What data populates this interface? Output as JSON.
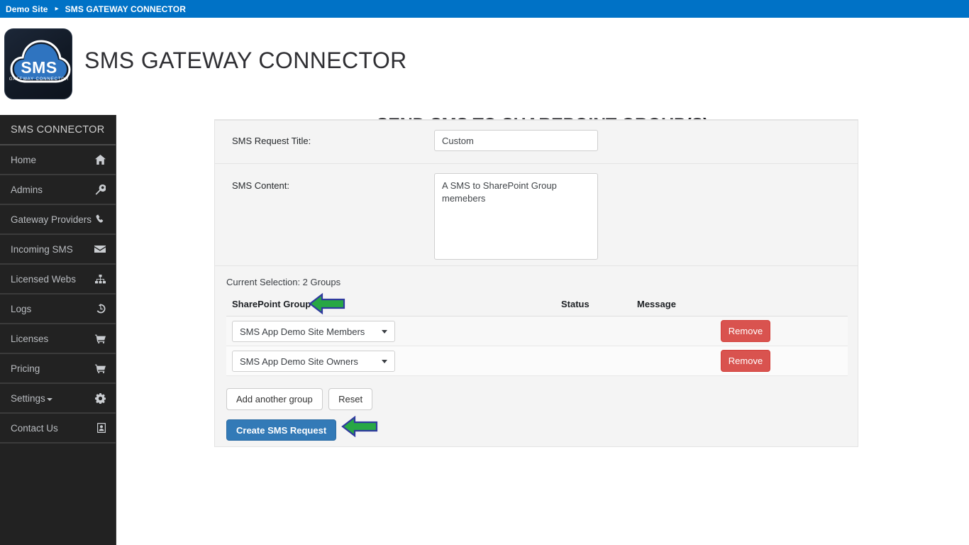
{
  "breadcrumb": {
    "site_label": "Demo Site",
    "separator_icon": "chevron-right-icon",
    "current_label": "SMS GATEWAY CONNECTOR"
  },
  "header": {
    "logo": {
      "icon": "sms-cloud-logo",
      "primary_text": "SMS",
      "secondary_text": "GATEWAY CONNECTOR"
    },
    "title": "SMS GATEWAY CONNECTOR"
  },
  "sidebar": {
    "heading": "SMS CONNECTOR",
    "items": [
      {
        "label": "Home",
        "icon": "home-icon"
      },
      {
        "label": "Admins",
        "icon": "wrench-icon"
      },
      {
        "label": "Gateway Providers",
        "icon": "phone-icon"
      },
      {
        "label": "Incoming SMS",
        "icon": "envelope-icon"
      },
      {
        "label": "Licensed Webs",
        "icon": "sitemap-icon"
      },
      {
        "label": "Logs",
        "icon": "history-icon"
      },
      {
        "label": "Licenses",
        "icon": "cart-icon"
      },
      {
        "label": "Pricing",
        "icon": "cart-icon"
      },
      {
        "label": "Settings",
        "icon": "gear-icon",
        "has_caret": true
      },
      {
        "label": "Contact Us",
        "icon": "address-book-icon"
      }
    ]
  },
  "main": {
    "page_title": "SEND SMS TO SHAREPOINT GROUP(S)",
    "form": {
      "title_label": "SMS Request Title:",
      "title_value": "Custom",
      "content_label": "SMS Content:",
      "content_value": "A SMS to SharePoint Group memebers"
    },
    "selection_note": "Current Selection: 2 Groups",
    "table": {
      "headers": {
        "group": "SharePoint Group",
        "status": "Status",
        "message": "Message"
      },
      "rows": [
        {
          "group": "SMS App Demo Site Members",
          "status": "",
          "message": "",
          "remove_label": "Remove"
        },
        {
          "group": "SMS App Demo Site Owners",
          "status": "",
          "message": "",
          "remove_label": "Remove"
        }
      ]
    },
    "buttons": {
      "add_group": "Add another group",
      "reset": "Reset",
      "create_request": "Create SMS Request"
    }
  },
  "annotations": {
    "arrows": [
      {
        "name": "arrow-pointing-to-sharepoint-group-header",
        "direction": "left"
      },
      {
        "name": "arrow-pointing-to-create-sms-request",
        "direction": "left"
      }
    ],
    "fill_color": "#28a745",
    "border_color": "#2f3a9e"
  },
  "colors": {
    "topbar": "#0072c6",
    "sidebar": "#222222",
    "primary": "#337ab7",
    "danger": "#d9534f",
    "panel": "#f4f4f4"
  }
}
